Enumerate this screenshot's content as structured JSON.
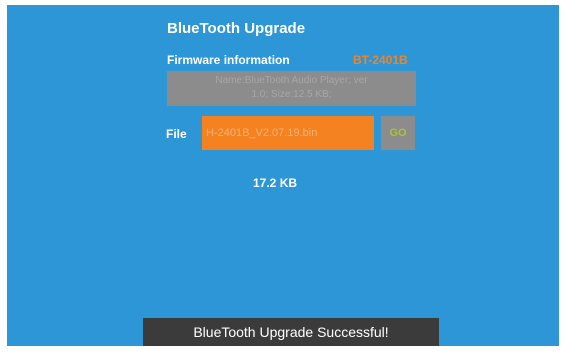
{
  "app": {
    "title": "BlueTooth Upgrade"
  },
  "firmware": {
    "label": "Firmware information",
    "model": "BT-2401B",
    "info_line1": "Name:BlueTooth Audio Player; ver",
    "info_line2": "1.0; Size:12.5 KB;"
  },
  "file": {
    "label": "File",
    "value": "H-2401B_V2.07.19.bin",
    "go_label": "GO",
    "size": "17.2 KB"
  },
  "toast": {
    "message": "BlueTooth Upgrade Successful!"
  },
  "colors": {
    "background": "#2d96d6",
    "accent": "#f58220",
    "disabled": "#8c8c8c",
    "go_text": "#a9c23a",
    "toast_bg": "#3b3b3b"
  }
}
